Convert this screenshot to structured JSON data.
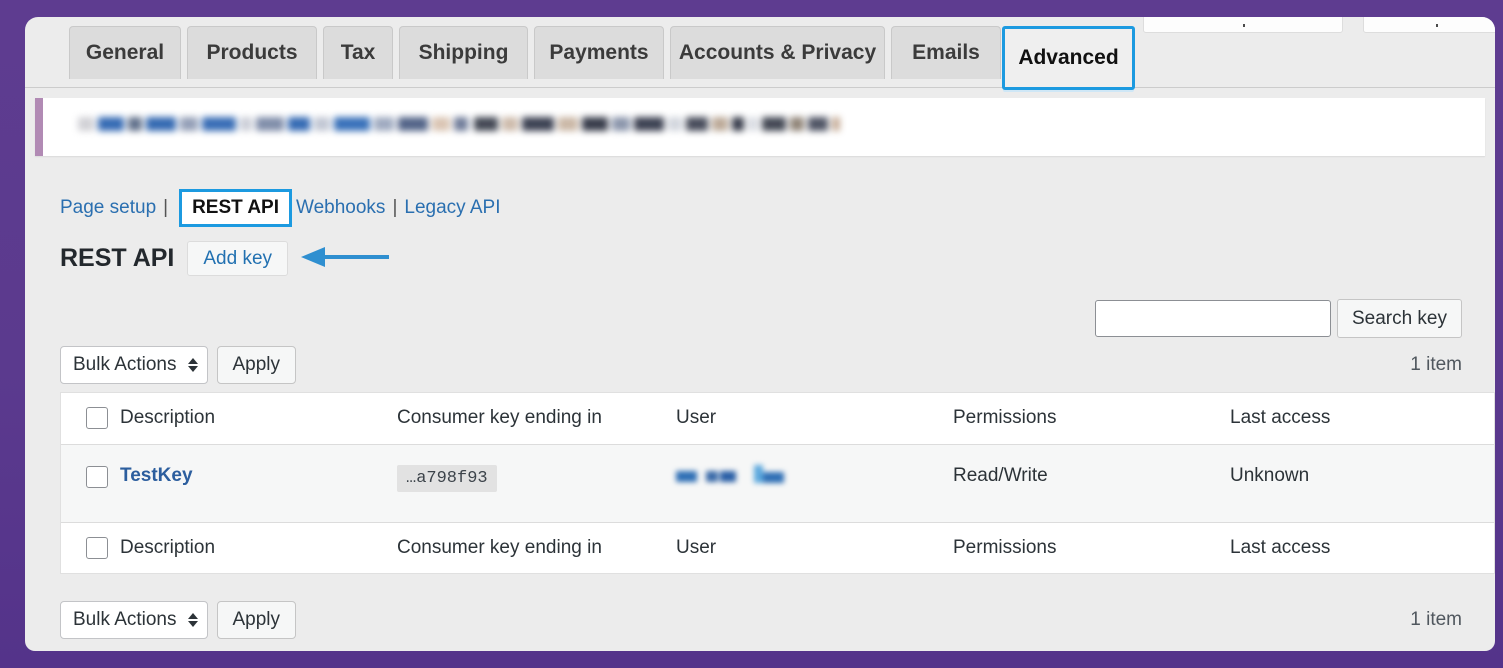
{
  "window": {
    "background_color": "#5b3a8e",
    "card_background": "#ececec"
  },
  "tabs": {
    "items": [
      {
        "label": "General",
        "active": false
      },
      {
        "label": "Products",
        "active": false
      },
      {
        "label": "Tax",
        "active": false
      },
      {
        "label": "Shipping",
        "active": false
      },
      {
        "label": "Payments",
        "active": false
      },
      {
        "label": "Accounts & Privacy",
        "active": false
      },
      {
        "label": "Emails",
        "active": false
      },
      {
        "label": "Advanced",
        "active": true
      }
    ],
    "highlight_color": "#1c9ae0"
  },
  "notice": {
    "accent_color": "#b18ab4",
    "text": ""
  },
  "subnav": {
    "page_setup": "Page setup",
    "rest_api": "REST API",
    "webhooks": "Webhooks",
    "separator": "|",
    "legacy_api": "Legacy API",
    "link_color": "#2a6fb0",
    "highlight_color": "#1c9ae0"
  },
  "page": {
    "title": "REST API",
    "add_key_label": "Add key",
    "add_key_color": "#2271b1",
    "annotation_arrow_color": "#2f8fd0"
  },
  "search": {
    "value": "",
    "placeholder": "",
    "button_label": "Search key"
  },
  "tablenav": {
    "bulk_actions_label": "Bulk Actions",
    "apply_label": "Apply",
    "item_count_top": "1 item",
    "item_count_bottom": "1 item"
  },
  "table": {
    "columns": [
      "Description",
      "Consumer key ending in",
      "User",
      "Permissions",
      "Last access"
    ],
    "rows": [
      {
        "description": "TestKey",
        "consumer_key": "…a798f93",
        "user": "",
        "user_redacted": true,
        "permissions": "Read/Write",
        "last_access": "Unknown"
      }
    ]
  }
}
